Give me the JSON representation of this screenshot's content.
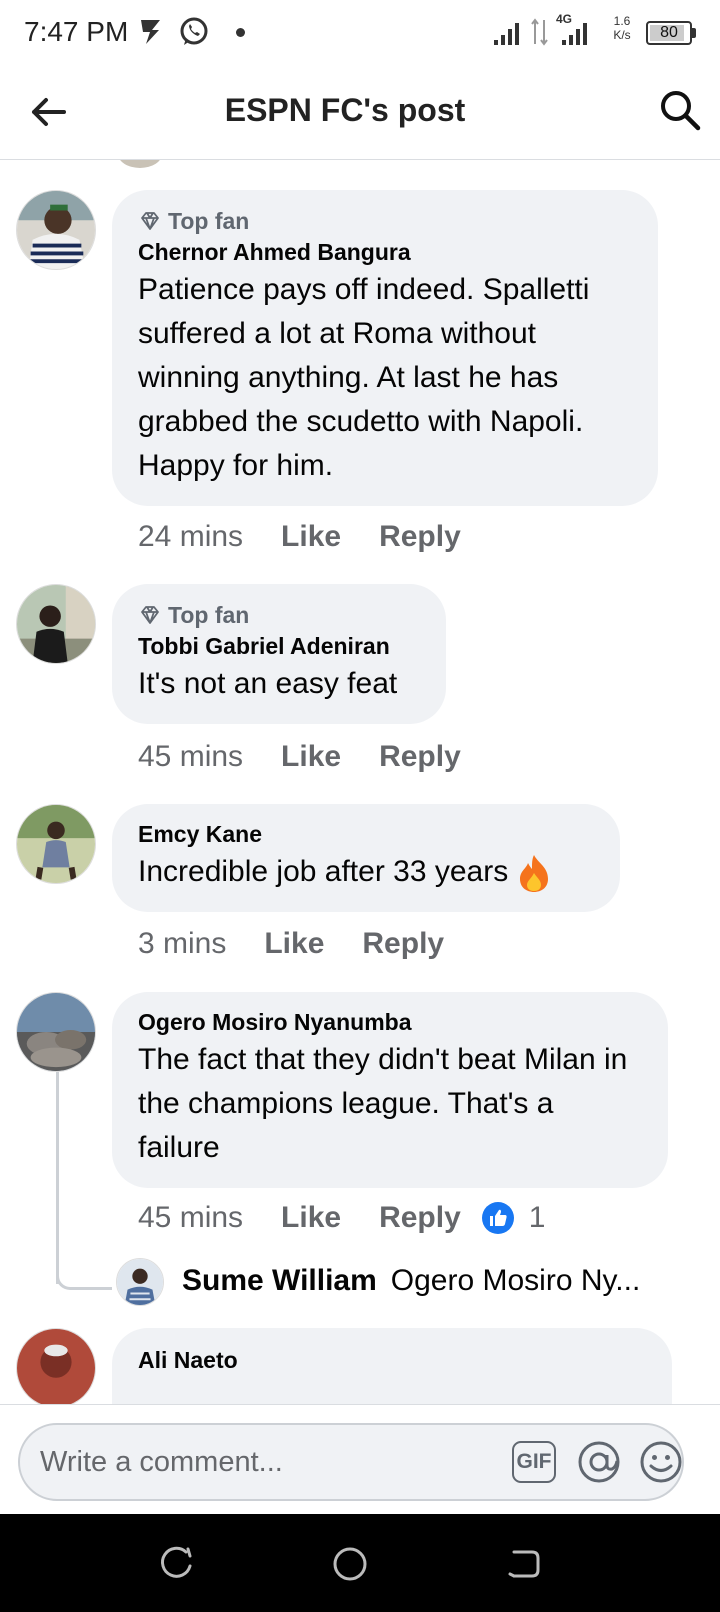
{
  "status_bar": {
    "time": "7:47 PM",
    "network": "4G",
    "speed_value": "1.6",
    "speed_unit": "K/s",
    "battery": "80"
  },
  "header": {
    "title": "ESPN FC's post",
    "back_icon": "arrow-left-icon",
    "search_icon": "search-icon"
  },
  "comments": [
    {
      "badge": "Top fan",
      "author": "Chernor Ahmed Bangura",
      "text": "Patience pays off indeed. Spalletti suffered a lot at Roma without winning anything. At last he has grabbed the scudetto with Napoli. Happy for him.",
      "time": "24 mins",
      "like_label": "Like",
      "reply_label": "Reply"
    },
    {
      "badge": "Top fan",
      "author": "Tobbi Gabriel Adeniran",
      "text": "It's not an easy feat",
      "time": "45 mins",
      "like_label": "Like",
      "reply_label": "Reply"
    },
    {
      "author": "Emcy Kane",
      "text": "Incredible job after 33 years",
      "time": "3 mins",
      "like_label": "Like",
      "reply_label": "Reply"
    },
    {
      "author": "Ogero Mosiro Nyanumba",
      "text": "The fact that they didn't beat Milan in the champions league. That's a failure",
      "time": "45 mins",
      "like_label": "Like",
      "reply_label": "Reply",
      "reaction_count": "1",
      "reply_preview": {
        "author": "Sume William",
        "text": "Ogero Mosiro Ny..."
      }
    },
    {
      "author": "Ali Naeto"
    }
  ],
  "composer": {
    "placeholder": "Write a comment...",
    "gif_label": "GIF"
  },
  "colors": {
    "bubble_bg": "#f0f2f5",
    "meta_text": "#65676b",
    "like_blue": "#1877f2",
    "fire": "#f5731c"
  }
}
